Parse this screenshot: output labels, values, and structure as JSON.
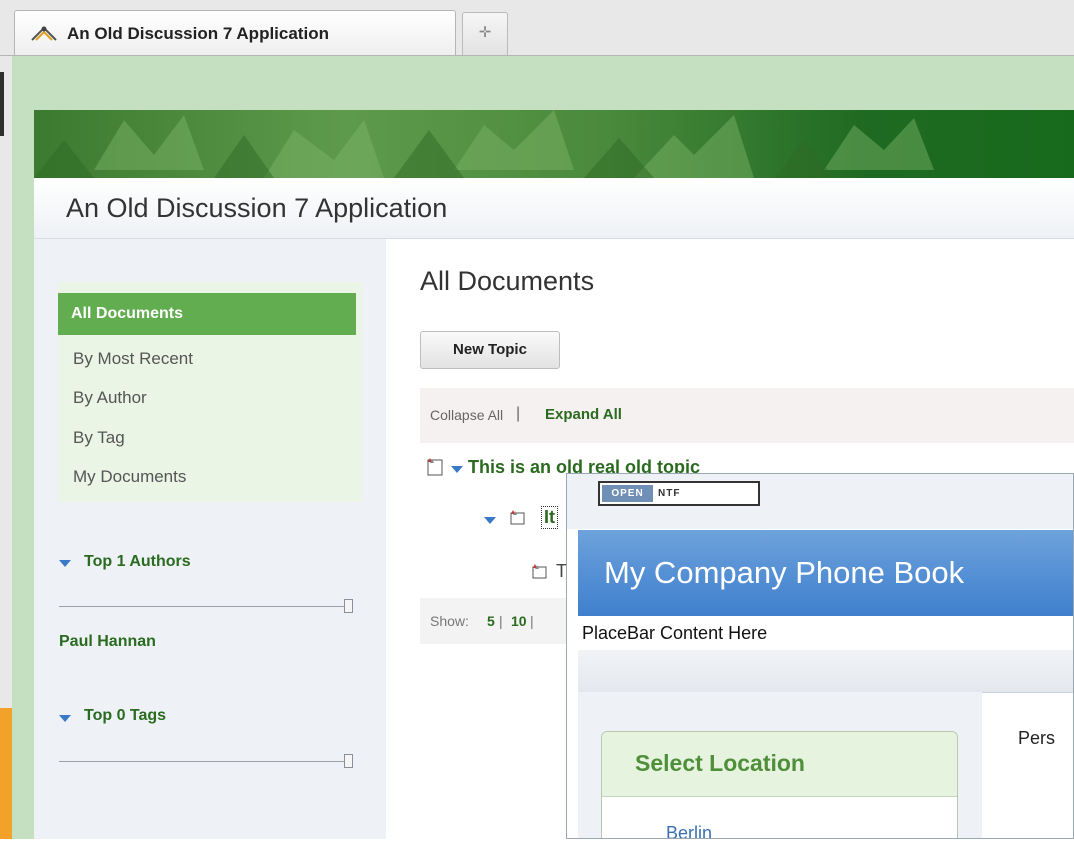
{
  "browser": {
    "tab_title": "An Old Discussion 7 Application",
    "new_tab_glyph": "✛",
    "tab_icon": "app-icon"
  },
  "app": {
    "title": "An Old Discussion 7 Application"
  },
  "sidebar": {
    "items": [
      {
        "label": "All Documents",
        "selected": true
      },
      {
        "label": "By Most Recent"
      },
      {
        "label": "By Author"
      },
      {
        "label": "By Tag"
      },
      {
        "label": "My Documents"
      }
    ],
    "authors": {
      "header": "Top 1 Authors",
      "names": [
        "Paul Hannan"
      ]
    },
    "tags": {
      "header": "Top 0 Tags"
    }
  },
  "main": {
    "title": "All Documents",
    "new_topic_label": "New Topic",
    "collapse_all": "Collapse All",
    "separator": "|",
    "expand_all": "Expand All",
    "topics": [
      {
        "text": "This is an old real old topic",
        "level": 0
      },
      {
        "text": "It",
        "level": 1
      },
      {
        "text": "T",
        "level": 2
      }
    ],
    "pager": {
      "show_label": "Show:",
      "options": [
        "5",
        "10"
      ],
      "separator": "|"
    }
  },
  "overlay": {
    "logo_open": "OPEN",
    "logo_ntf": "NTF",
    "title": "My Company Phone Book",
    "placebar": "PlaceBar Content Here",
    "location_title": "Select Location",
    "locations": [
      "Berlin"
    ],
    "right_text": "Pers"
  },
  "colors": {
    "accent_green": "#62ad50",
    "link_green": "#2a6b1f",
    "header_blue": "#3f7fcd"
  }
}
